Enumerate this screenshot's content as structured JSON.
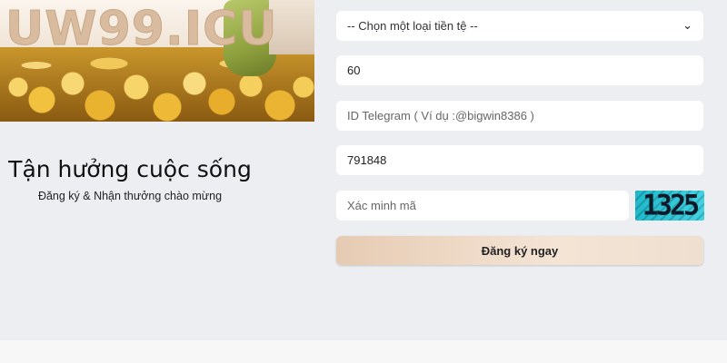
{
  "brand": {
    "logo_text": "UW99.ICU"
  },
  "promo": {
    "headline": "Tận hưởng cuộc sống",
    "subheadline": "Đăng ký & Nhận thưởng chào mừng"
  },
  "form": {
    "currency_select": {
      "selected": "-- Chọn một loại tiền tệ --"
    },
    "amount_field": {
      "value": "60"
    },
    "telegram_field": {
      "value": "",
      "placeholder": "ID Telegram ( Ví dụ :@bigwin8386 )"
    },
    "phone_field": {
      "value": "791848"
    },
    "captcha_field": {
      "value": "",
      "placeholder": "Xác minh mã"
    },
    "captcha_image_text": "1325",
    "submit_label": "Đăng ký ngay"
  },
  "icons": {
    "select_arrow": "chevron-down-icon"
  },
  "colors": {
    "page_bg": "#eceef1",
    "button_gradient_start": "#e6cbb3",
    "button_gradient_end": "#eedfd0",
    "captcha_bg": "#32c8d8",
    "logo": "#d9bca0"
  }
}
